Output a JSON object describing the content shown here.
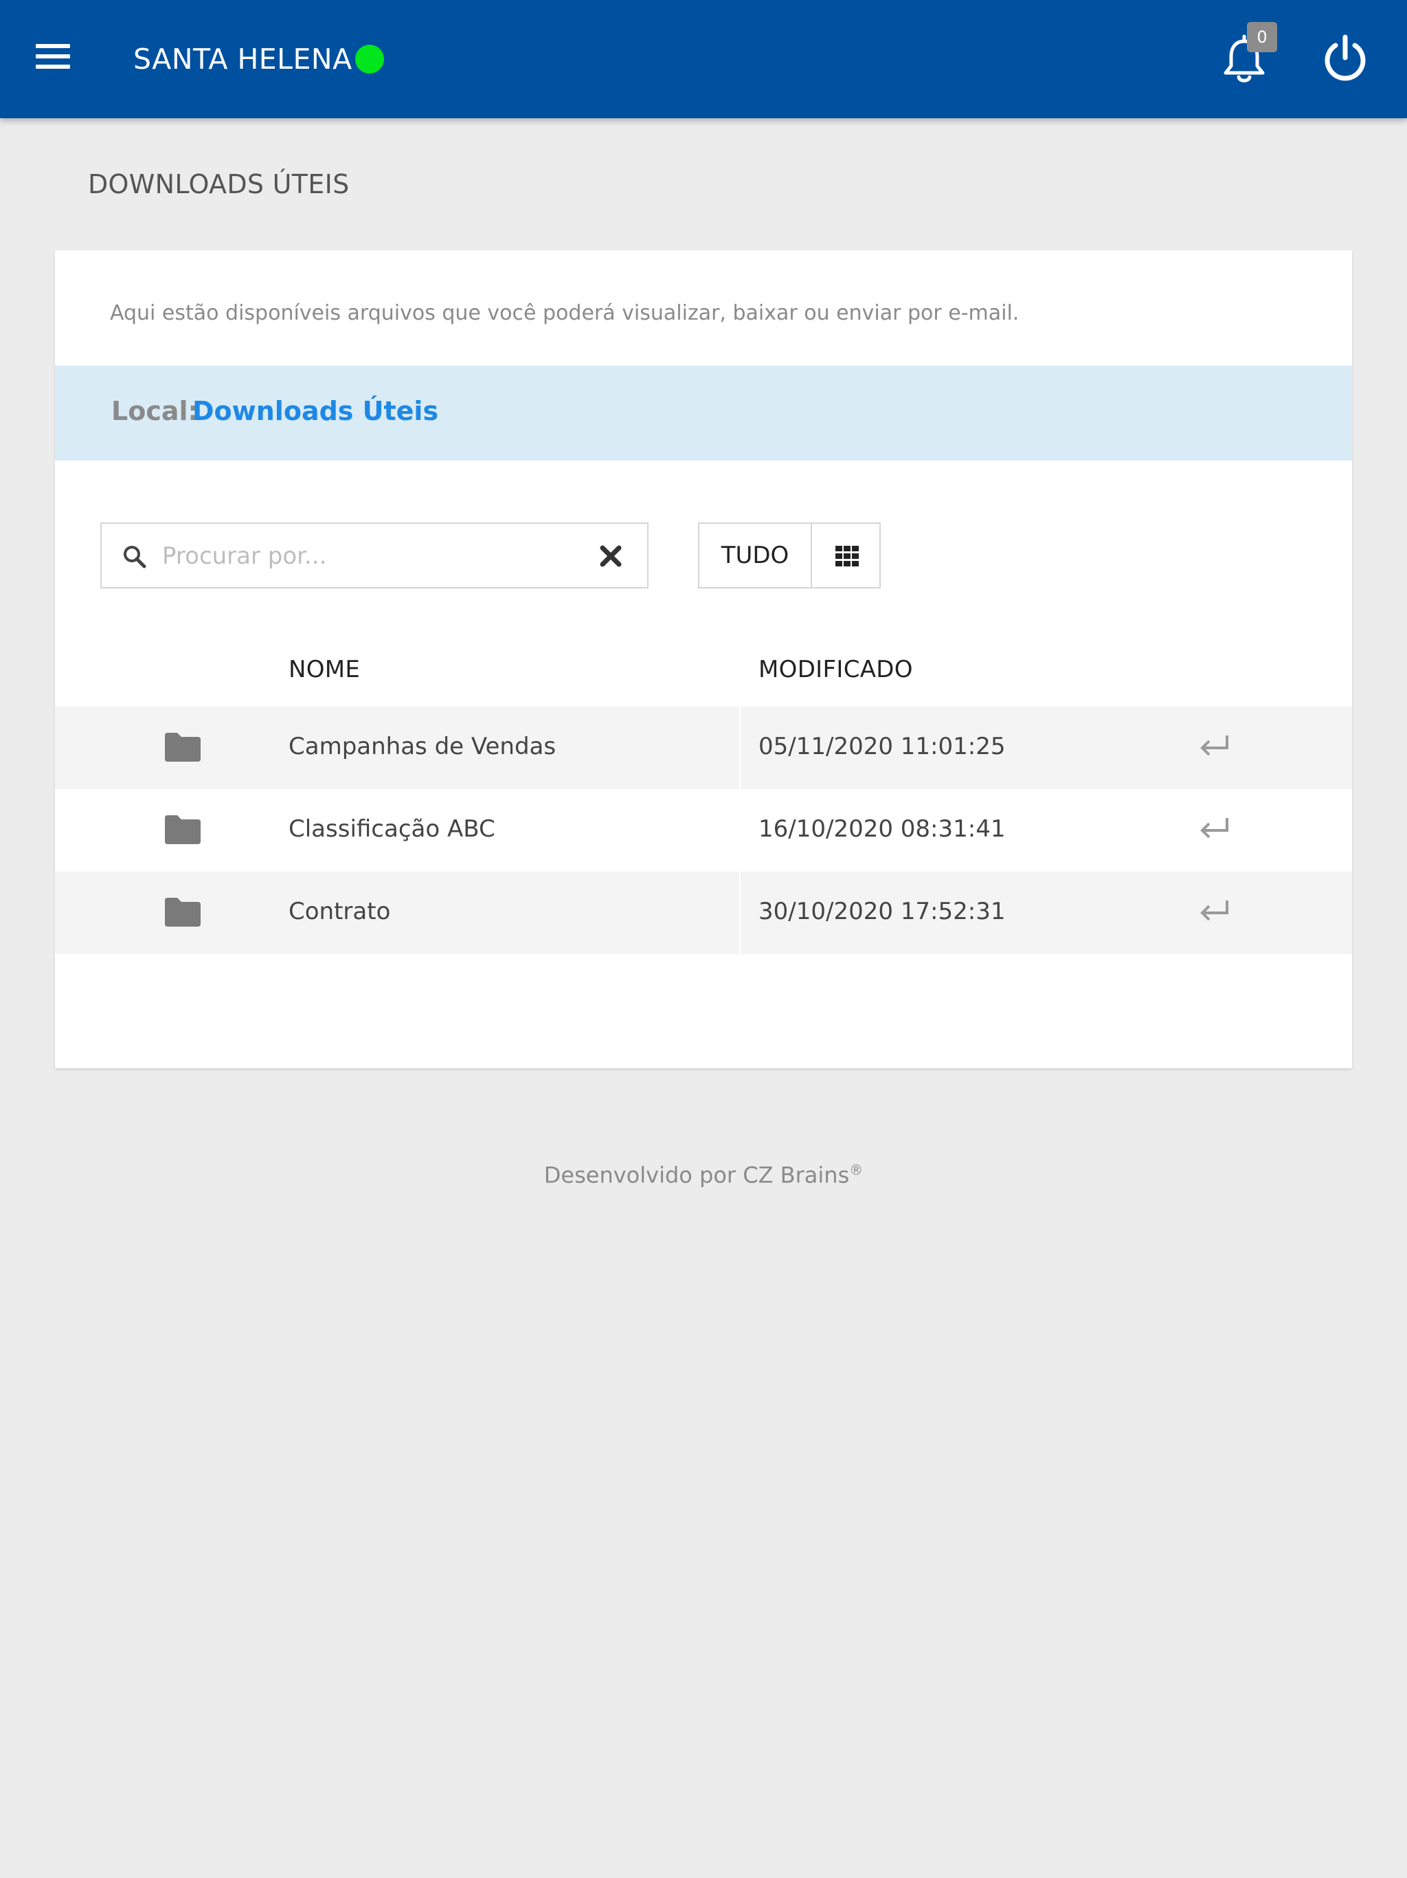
{
  "header": {
    "app_name": "SANTA HELENA",
    "notification_count": "0",
    "status_color": "#00e61c",
    "bar_color": "#0050a0",
    "icons": [
      "menu-icon",
      "bell-icon",
      "power-icon"
    ]
  },
  "page": {
    "title": "DOWNLOADS ÚTEIS",
    "intro": "Aqui estão disponíveis arquivos que você poderá visualizar, baixar ou enviar por e-mail."
  },
  "location": {
    "label": "Local:",
    "value": "Downloads Úteis"
  },
  "search": {
    "placeholder": "Procurar por...",
    "value": ""
  },
  "filters": {
    "all_label": "TUDO"
  },
  "table": {
    "headers": {
      "name": "NOME",
      "modified": "MODIFICADO"
    },
    "rows": [
      {
        "icon": "folder-icon",
        "name": "Campanhas de Vendas",
        "modified": "05/11/2020 11:01:25"
      },
      {
        "icon": "folder-icon",
        "name": "Classificação ABC",
        "modified": "16/10/2020 08:31:41"
      },
      {
        "icon": "folder-icon",
        "name": "Contrato",
        "modified": "30/10/2020 17:52:31"
      }
    ]
  },
  "footer": {
    "text": "Desenvolvido por CZ Brains",
    "mark": "®"
  }
}
